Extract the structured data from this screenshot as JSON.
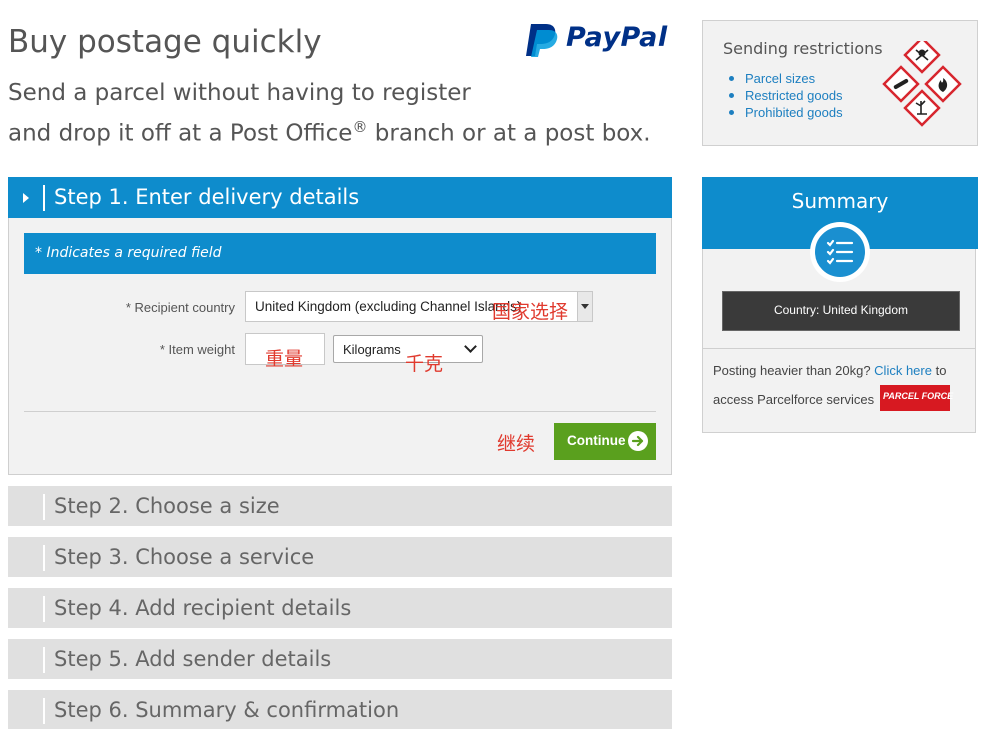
{
  "header": {
    "title": "Buy postage quickly",
    "subtitle_line1": "Send a parcel without having to register",
    "subtitle_line2_a": "and drop it off at a Post Office",
    "subtitle_registered": "®",
    "subtitle_line2_b": " branch or at a post box.",
    "paypal_logo_text": "PayPal"
  },
  "colors": {
    "accent_blue": "#0e8ccc",
    "continue_green": "#5aa01e",
    "annotation_red": "#e03a2e",
    "link_blue": "#1d7fc0",
    "paypal_navy": "#003087"
  },
  "step1": {
    "title": "Step 1. Enter delivery details",
    "required_note": "* Indicates a required field",
    "country_label": "* Recipient country",
    "country_value": "United Kingdom (excluding Channel Islands)",
    "weight_label": "* Item weight",
    "weight_value": "",
    "unit_value": "Kilograms",
    "continue_label": "Continue",
    "annotations": {
      "country": "国家选择",
      "weight": "重量",
      "unit": "千克",
      "continue": "继续"
    }
  },
  "steps": [
    {
      "title": "Step 2. Choose a size"
    },
    {
      "title": "Step 3. Choose a service"
    },
    {
      "title": "Step 4. Add recipient details"
    },
    {
      "title": "Step 5. Add sender details"
    },
    {
      "title": "Step 6. Summary & confirmation"
    }
  ],
  "restrictions": {
    "title": "Sending restrictions",
    "items": [
      "Parcel sizes",
      "Restricted goods",
      "Prohibited goods"
    ],
    "icon": "hazard-symbols-icon"
  },
  "summary": {
    "title": "Summary",
    "icon": "checklist-icon",
    "country_text": "Country: United Kingdom",
    "heavier_text": "Posting heavier than 20kg? ",
    "click_here": "Click here",
    "to_text": " to",
    "access_text": "access Parcelforce services",
    "parcelforce_logo_text": "PARCEL FORCE"
  }
}
